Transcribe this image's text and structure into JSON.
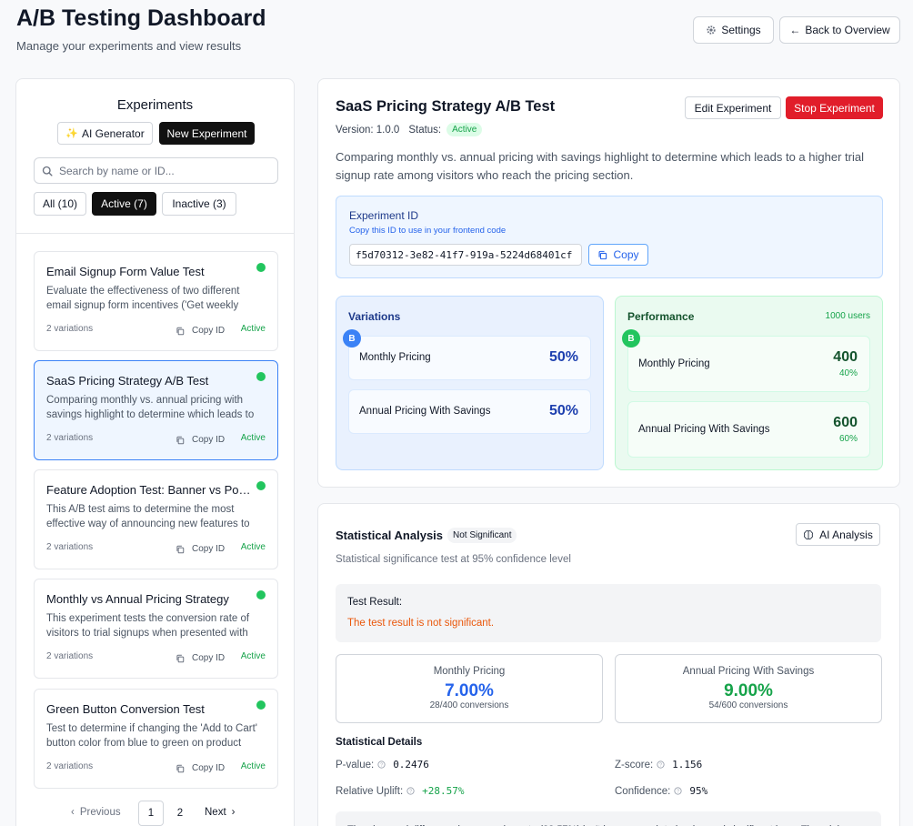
{
  "header": {
    "title": "A/B Testing Dashboard",
    "subtitle": "Manage your experiments and view results",
    "settings_label": "Settings",
    "back_label": "Back to Overview"
  },
  "sidebar": {
    "title": "Experiments",
    "ai_generator_label": "AI Generator",
    "new_experiment_label": "New Experiment",
    "search_placeholder": "Search by name or ID...",
    "filters": [
      {
        "label": "All (10)",
        "active": false
      },
      {
        "label": "Active (7)",
        "active": true
      },
      {
        "label": "Inactive (3)",
        "active": false
      }
    ],
    "experiments": [
      {
        "name": "Email Signup Form Value Test",
        "description": "Evaluate the effectiveness of two different email signup form incentives ('Get weekly tips' vs 'Get a free guide')",
        "variations": "2 variations",
        "copy_label": "Copy ID",
        "status": "Active",
        "selected": false
      },
      {
        "name": "SaaS Pricing Strategy A/B Test",
        "description": "Comparing monthly vs. annual pricing with savings highlight to determine which leads to a higher trial signup rate",
        "variations": "2 variations",
        "copy_label": "Copy ID",
        "status": "Active",
        "selected": true
      },
      {
        "name": "Feature Adoption Test: Banner vs Popup",
        "description": "This A/B test aims to determine the most effective way of announcing new features to users",
        "variations": "2 variations",
        "copy_label": "Copy ID",
        "status": "Active",
        "selected": false
      },
      {
        "name": "Monthly vs Annual Pricing Strategy",
        "description": "This experiment tests the conversion rate of visitors to trial signups when presented with different pricing",
        "variations": "2 variations",
        "copy_label": "Copy ID",
        "status": "Active",
        "selected": false
      },
      {
        "name": "Green Button Conversion Test",
        "description": "Test to determine if changing the 'Add to Cart' button color from blue to green on product pages",
        "variations": "2 variations",
        "copy_label": "Copy ID",
        "status": "Active",
        "selected": false
      }
    ],
    "pagination": {
      "previous": "Previous",
      "pages": [
        "1",
        "2"
      ],
      "current": "1",
      "next": "Next"
    }
  },
  "experiment": {
    "title": "SaaS Pricing Strategy A/B Test",
    "version_label": "Version: 1.0.0",
    "status_label": "Status:",
    "status": "Active",
    "edit_label": "Edit Experiment",
    "stop_label": "Stop Experiment",
    "description": "Comparing monthly vs. annual pricing with savings highlight to determine which leads to a higher trial signup rate among visitors who reach the pricing section.",
    "id_box": {
      "title": "Experiment ID",
      "subtitle": "Copy this ID to use in your frontend code",
      "value": "f5d70312-3e82-41f7-919a-5224d68401cf",
      "copy_label": "Copy"
    },
    "variations": {
      "title": "Variations",
      "badge": "B",
      "items": [
        {
          "name": "Monthly Pricing",
          "percent": "50%"
        },
        {
          "name": "Annual Pricing With Savings",
          "percent": "50%"
        }
      ]
    },
    "performance": {
      "title": "Performance",
      "users": "1000 users",
      "badge": "B",
      "items": [
        {
          "name": "Monthly Pricing",
          "count": "400",
          "percent": "40%"
        },
        {
          "name": "Annual Pricing With Savings",
          "count": "600",
          "percent": "60%"
        }
      ]
    }
  },
  "stats": {
    "title": "Statistical Analysis",
    "badge": "Not Significant",
    "ai_label": "AI Analysis",
    "subtitle": "Statistical significance test at 95% confidence level",
    "result_label": "Test Result:",
    "result_text": "The test result is not significant.",
    "comparison": [
      {
        "name": "Monthly Pricing",
        "rate": "7.00%",
        "conversions": "28/400 conversions",
        "color": "#2563eb"
      },
      {
        "name": "Annual Pricing With Savings",
        "rate": "9.00%",
        "conversions": "54/600 conversions",
        "color": "#16a34a"
      }
    ],
    "details_title": "Statistical Details",
    "details": {
      "p_value_label": "P-value:",
      "p_value": "0.2476",
      "z_score_label": "Z-score:",
      "z_score": "1.156",
      "uplift_label": "Relative Uplift:",
      "uplift": "+28.57%",
      "confidence_label": "Confidence:",
      "confidence": "95%"
    },
    "note": "The observed difference in conversion rate (28.57%) isn't large enough to be deemed significant here. The minimum"
  },
  "colors": {
    "accent_blue": "#2563eb",
    "success_green": "#16a34a",
    "danger_red": "#e11d2a",
    "warning_orange": "#ea580c"
  }
}
